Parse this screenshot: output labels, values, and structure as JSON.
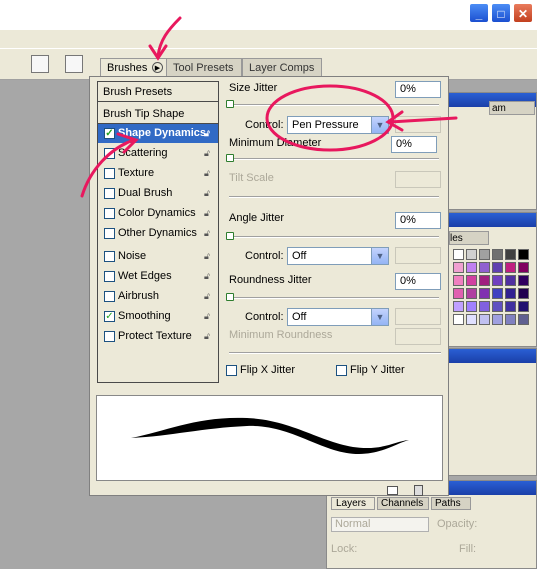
{
  "window": {
    "minimize_glyph": "_",
    "maximize_glyph": "□",
    "close_glyph": "✕"
  },
  "tabs": {
    "brushes": "Brushes",
    "tool_presets": "Tool Presets",
    "layer_comps": "Layer Comps"
  },
  "brushes_panel": {
    "presets_label": "Brush Presets",
    "tip_shape_label": "Brush Tip Shape",
    "items": [
      {
        "label": "Shape Dynamics",
        "checked": true,
        "selected": true
      },
      {
        "label": "Scattering",
        "checked": false
      },
      {
        "label": "Texture",
        "checked": false
      },
      {
        "label": "Dual Brush",
        "checked": false
      },
      {
        "label": "Color Dynamics",
        "checked": false
      },
      {
        "label": "Other Dynamics",
        "checked": false
      },
      {
        "label": "Noise",
        "checked": false
      },
      {
        "label": "Wet Edges",
        "checked": false
      },
      {
        "label": "Airbrush",
        "checked": false
      },
      {
        "label": "Smoothing",
        "checked": true
      },
      {
        "label": "Protect Texture",
        "checked": false
      }
    ],
    "size_jitter_label": "Size Jitter",
    "size_jitter_value": "0%",
    "control_label": "Control:",
    "size_control_value": "Pen Pressure",
    "min_diameter_label": "Minimum Diameter",
    "min_diameter_value": "0%",
    "tilt_scale_label": "Tilt Scale",
    "angle_jitter_label": "Angle Jitter",
    "angle_jitter_value": "0%",
    "angle_control_value": "Off",
    "roundness_jitter_label": "Roundness Jitter",
    "roundness_jitter_value": "0%",
    "roundness_control_value": "Off",
    "min_roundness_label": "Minimum Roundness",
    "flip_x_label": "Flip X Jitter",
    "flip_y_label": "Flip Y Jitter"
  },
  "right_palettes": {
    "navigator_tab_fragment": "am",
    "swatches_tab_fragment": "les",
    "layers_tab": "Layers",
    "channels_tab": "Channels",
    "paths_tab": "Paths",
    "blend_mode": "Normal",
    "opacity_label": "Opacity:",
    "lock_label": "Lock:",
    "fill_label": "Fill:"
  },
  "colors": {
    "selection_blue": "#316ac5",
    "annotation_pink": "#e8185e",
    "panel_bg": "#ece9d8"
  }
}
